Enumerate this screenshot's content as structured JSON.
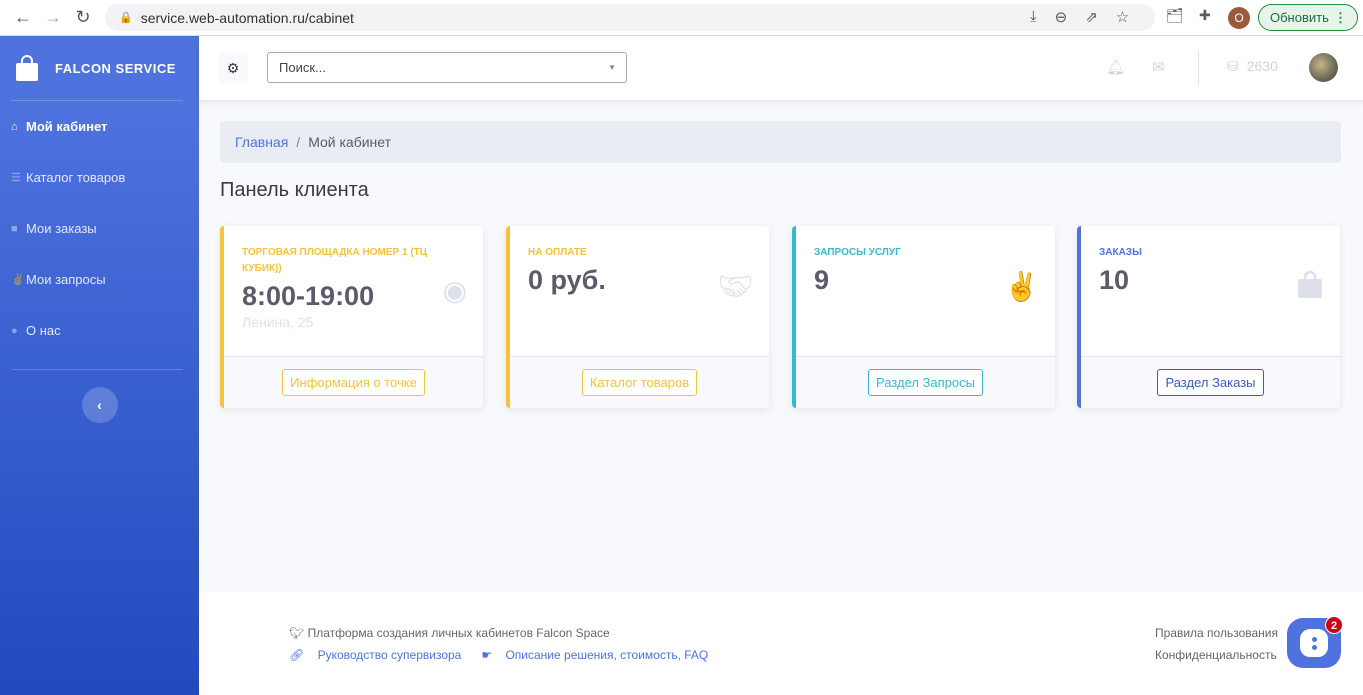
{
  "browser": {
    "url": "service.web-automation.ru/cabinet",
    "profile_initial": "O",
    "update_label": "Обновить"
  },
  "sidebar": {
    "brand": "FALCON SERVICE",
    "items": [
      {
        "label": "Мой кабинет",
        "icon": "home-icon"
      },
      {
        "label": "Каталог товаров",
        "icon": "bars-icon"
      },
      {
        "label": "Мои заказы",
        "icon": "shopping-bag-icon"
      },
      {
        "label": "Мои запросы",
        "icon": "hand-peace-icon"
      },
      {
        "label": "О нас",
        "icon": "info-circle-icon"
      }
    ]
  },
  "topbar": {
    "search_placeholder": "Поиск...",
    "coins": "2630"
  },
  "breadcrumb": {
    "home": "Главная",
    "current": "Мой кабинет"
  },
  "page_title": "Панель клиента",
  "cards": [
    {
      "label": "Торговая площадка номер 1 (ТЦ Кубик))",
      "value": "8:00-19:00",
      "sub": "Ленина, 25",
      "button": "Информация о точке",
      "color": "#f6c23e",
      "icon": "dot-circle-icon"
    },
    {
      "label": "На оплате",
      "value": "0 руб.",
      "button": "Каталог товаров",
      "color": "#f6c23e",
      "icon": "handshake-icon"
    },
    {
      "label": "Запросы услуг",
      "value": "9",
      "button": "Раздел Запросы",
      "color": "#36b9cc",
      "icon": "hand-peace-icon"
    },
    {
      "label": "Заказы",
      "value": "10",
      "button": "Раздел Заказы",
      "color": "#4e73df",
      "icon": "shopping-bag-icon"
    }
  ],
  "footer": {
    "platform": "Платформа создания личных кабинетов Falcon Space",
    "guide": "Руководство супервизора",
    "description": "Описание решения, стоимость, FAQ",
    "terms": "Правила пользования",
    "privacy": "Конфиденциальность"
  },
  "chat": {
    "badge": "2"
  }
}
